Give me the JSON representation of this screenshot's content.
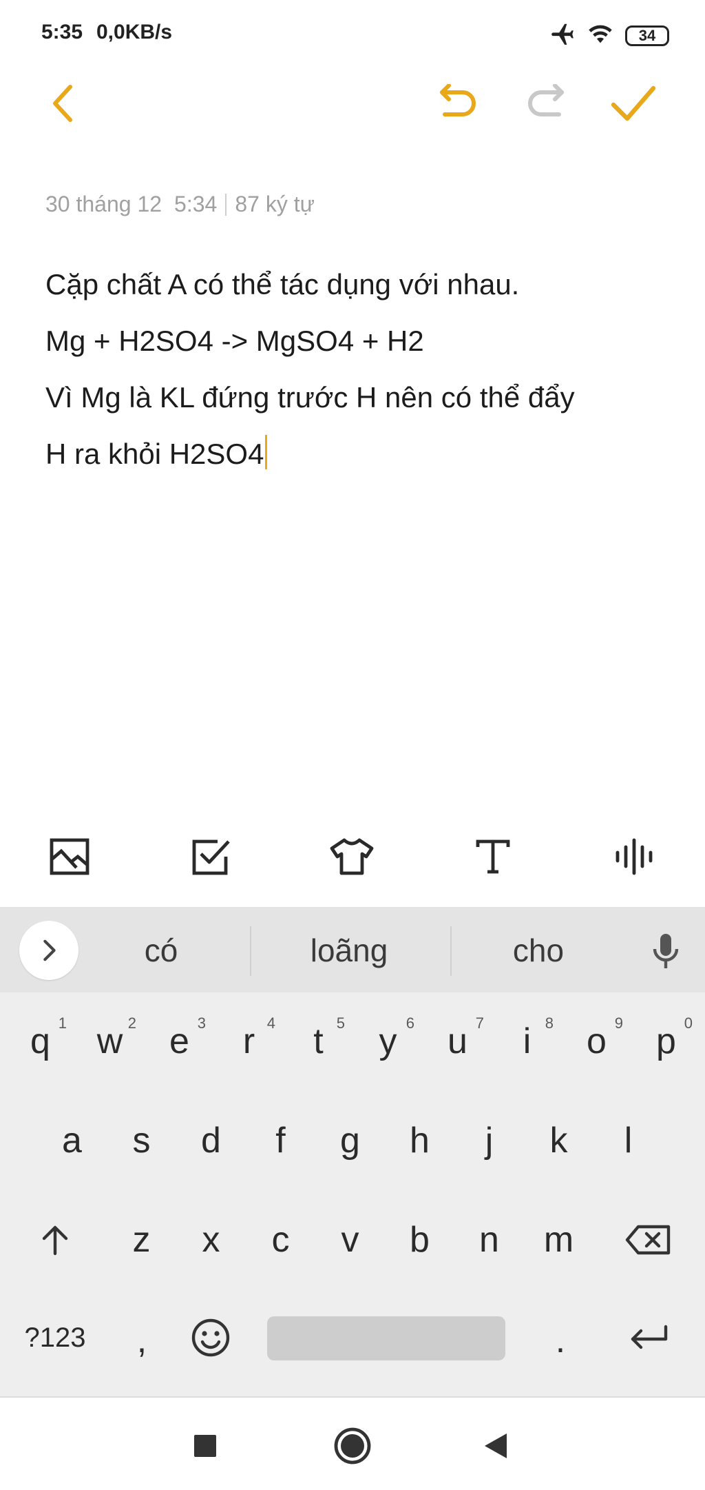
{
  "status_bar": {
    "time": "5:35",
    "network_speed": "0,0KB/s",
    "battery_level": "34",
    "icons": [
      "airplane-icon",
      "wifi-icon",
      "battery-icon"
    ]
  },
  "toolbar": {
    "back_icon": "chevron-left-icon",
    "undo_icon": "undo-icon",
    "redo_icon": "redo-icon",
    "confirm_icon": "check-icon"
  },
  "meta": {
    "date": "30 tháng 12",
    "time": "5:34",
    "char_count": "87 ký tự"
  },
  "note": {
    "lines": [
      "Cặp chất A có thể tác dụng với nhau.",
      "Mg + H2SO4 -> MgSO4 + H2",
      "Vì Mg là KL đứng trước H nên có thể đẩy",
      "H ra khỏi H2SO4"
    ]
  },
  "format_bar": {
    "icons": [
      "image-icon",
      "checkbox-icon",
      "shirt-icon",
      "text-format-icon",
      "audio-wave-icon"
    ]
  },
  "keyboard": {
    "suggestions": [
      "có",
      "loãng",
      "cho"
    ],
    "row1": [
      {
        "key": "q",
        "hint": "1"
      },
      {
        "key": "w",
        "hint": "2"
      },
      {
        "key": "e",
        "hint": "3"
      },
      {
        "key": "r",
        "hint": "4"
      },
      {
        "key": "t",
        "hint": "5"
      },
      {
        "key": "y",
        "hint": "6"
      },
      {
        "key": "u",
        "hint": "7"
      },
      {
        "key": "i",
        "hint": "8"
      },
      {
        "key": "o",
        "hint": "9"
      },
      {
        "key": "p",
        "hint": "0"
      }
    ],
    "row2": [
      "a",
      "s",
      "d",
      "f",
      "g",
      "h",
      "j",
      "k",
      "l"
    ],
    "row3": [
      "z",
      "x",
      "c",
      "v",
      "b",
      "n",
      "m"
    ],
    "symbols_key": "?123",
    "comma_key": ",",
    "period_key": "."
  },
  "colors": {
    "accent": "#e8a81a",
    "disabled": "#c8c8c8",
    "keyboard_bg": "#eeeeee",
    "suggestion_bg": "#e4e4e4"
  }
}
